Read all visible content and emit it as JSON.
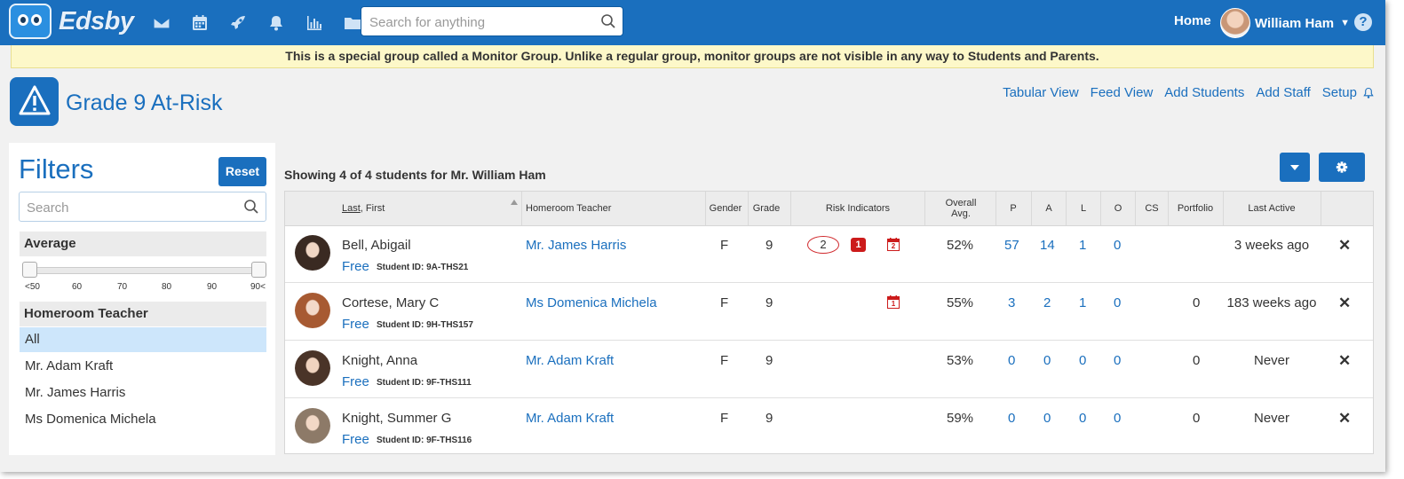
{
  "app": {
    "logo_text": "Edsby"
  },
  "topbar": {
    "search_placeholder": "Search for anything",
    "home_label": "Home",
    "user_name": "William Ham",
    "nav_icons": [
      "mail-icon",
      "calendar-icon",
      "rocket-icon",
      "bell-icon",
      "chart-icon",
      "folder-icon"
    ],
    "help_label": "?"
  },
  "notice": {
    "text": "This is a special group called a Monitor Group. Unlike a regular group, monitor groups are not visible in any way to Students and Parents."
  },
  "group": {
    "title": "Grade 9 At-Risk",
    "actions": [
      "Tabular View",
      "Feed View",
      "Add Students",
      "Add Staff",
      "Setup"
    ]
  },
  "filters": {
    "title": "Filters",
    "reset_label": "Reset",
    "search_placeholder": "Search",
    "average_label": "Average",
    "slider_min": 0,
    "slider_max": 1,
    "ticks": [
      "<50",
      "60",
      "70",
      "80",
      "90",
      "90<"
    ],
    "homeroom_label": "Homeroom Teacher",
    "homeroom_options": [
      "All",
      "Mr. Adam Kraft",
      "Mr. James Harris",
      "Ms Domenica Michela"
    ],
    "selected_homeroom": "All"
  },
  "table": {
    "showing_text": "Showing 4 of 4 students for Mr. William Ham",
    "headers": {
      "last": "Last",
      "first": ", First",
      "homeroom": "Homeroom Teacher",
      "gender": "Gender",
      "grade": "Grade",
      "risk": "Risk Indicators",
      "overall_1": "Overall",
      "overall_2": "Avg.",
      "p": "P",
      "a": "A",
      "l": "L",
      "o": "O",
      "cs": "CS",
      "portfolio": "Portfolio",
      "last_active": "Last Active"
    },
    "sid_label": "Student ID:",
    "free_label": "Free",
    "rows": [
      {
        "name": "Bell, Abigail",
        "student_id": "9A-THS21",
        "teacher": "Mr. James Harris",
        "gender": "F",
        "grade": "9",
        "risk_oval": "2",
        "risk_badge": "1",
        "risk_cal_num": "2",
        "avg": "52%",
        "p": "57",
        "a": "14",
        "l": "1",
        "o": "0",
        "portfolio": "",
        "last_active": "3 weeks ago"
      },
      {
        "name": "Cortese, Mary C",
        "student_id": "9H-THS157",
        "teacher": "Ms Domenica Michela",
        "gender": "F",
        "grade": "9",
        "risk_cal_num": "1",
        "avg": "55%",
        "p": "3",
        "a": "2",
        "l": "1",
        "o": "0",
        "portfolio": "0",
        "last_active": "183 weeks ago"
      },
      {
        "name": "Knight, Anna",
        "student_id": "9F-THS111",
        "teacher": "Mr. Adam Kraft",
        "gender": "F",
        "grade": "9",
        "avg": "53%",
        "p": "0",
        "a": "0",
        "l": "0",
        "o": "0",
        "portfolio": "0",
        "last_active": "Never"
      },
      {
        "name": "Knight, Summer G",
        "student_id": "9F-THS116",
        "teacher": "Mr. Adam Kraft",
        "gender": "F",
        "grade": "9",
        "avg": "59%",
        "p": "0",
        "a": "0",
        "l": "0",
        "o": "0",
        "portfolio": "0",
        "last_active": "Never"
      }
    ],
    "delete_glyph": "✕"
  }
}
